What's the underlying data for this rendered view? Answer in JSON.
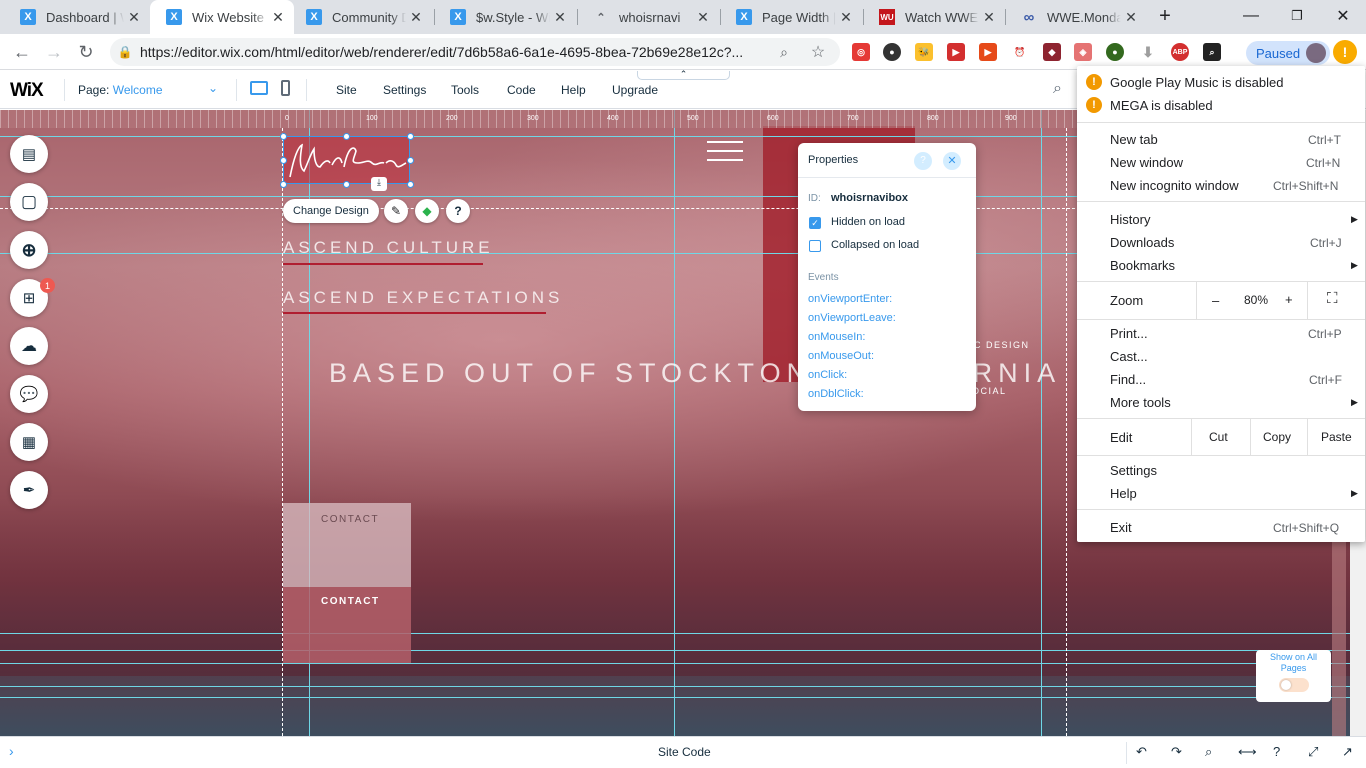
{
  "browser": {
    "tabs": [
      {
        "title": "Dashboard | Wix",
        "icon": "wix-icon"
      },
      {
        "title": "Wix Website Editor",
        "icon": "wix-icon"
      },
      {
        "title": "Community Discussion",
        "icon": "wix-icon"
      },
      {
        "title": "$w.Style - Wix Code",
        "icon": "wix-icon"
      },
      {
        "title": "whoisrnavi",
        "icon": "site-icon"
      },
      {
        "title": "Page Width | Help",
        "icon": "wix-icon"
      },
      {
        "title": "Watch WWE Raw",
        "icon": "wwe-icon"
      },
      {
        "title": "WWE.Monday Night",
        "icon": "infinity-icon"
      }
    ],
    "url": "https://editor.wix.com/html/editor/web/renderer/edit/7d6b58a6-6a1e-4695-8bea-72b69e28e12c?...",
    "paused_label": "Paused"
  },
  "wix_bar": {
    "logo": "WiX",
    "page_label": "Page:",
    "page_value": "Welcome",
    "menu": [
      "Site",
      "Settings",
      "Tools",
      "Code",
      "Help",
      "Upgrade"
    ]
  },
  "ruler": {
    "ticks": [
      "0",
      "100",
      "200",
      "300",
      "400",
      "500",
      "600",
      "700",
      "800",
      "900"
    ]
  },
  "stage": {
    "change_design": "Change Design",
    "heading1": "ASCEND CULTURE",
    "heading2": "ASCEND EXPECTATIONS",
    "heading3": "BASED OUT OF STOCKTON, CALIFORNIA",
    "partial1": "IC DESIGN",
    "partial2": "OCIAL",
    "contact1": "CONTACT",
    "contact2": "CONTACT",
    "show_on_all": "Show on All Pages",
    "add_badge": "1"
  },
  "properties": {
    "title": "Properties",
    "id_label": "ID:",
    "id_value": "whoisrnavibox",
    "hidden": {
      "label": "Hidden on load",
      "checked": true
    },
    "collapsed": {
      "label": "Collapsed on load",
      "checked": false
    },
    "events_title": "Events",
    "events": [
      "onViewportEnter:",
      "onViewportLeave:",
      "onMouseIn:",
      "onMouseOut:",
      "onClick:",
      "onDblClick:"
    ]
  },
  "bottom": {
    "site_code": "Site Code"
  },
  "chrome_menu": {
    "warnings": [
      "Google Play Music is disabled",
      "MEGA is disabled"
    ],
    "new_tab": {
      "label": "New tab",
      "shortcut": "Ctrl+T"
    },
    "new_window": {
      "label": "New window",
      "shortcut": "Ctrl+N"
    },
    "incognito": {
      "label": "New incognito window",
      "shortcut": "Ctrl+Shift+N"
    },
    "history": "History",
    "downloads": {
      "label": "Downloads",
      "shortcut": "Ctrl+J"
    },
    "bookmarks": "Bookmarks",
    "zoom": {
      "label": "Zoom",
      "minus": "–",
      "value": "80%",
      "plus": "+"
    },
    "print": {
      "label": "Print...",
      "shortcut": "Ctrl+P"
    },
    "cast": "Cast...",
    "find": {
      "label": "Find...",
      "shortcut": "Ctrl+F"
    },
    "more_tools": "More tools",
    "edit": {
      "label": "Edit",
      "cut": "Cut",
      "copy": "Copy",
      "paste": "Paste"
    },
    "settings": "Settings",
    "help": "Help",
    "exit": {
      "label": "Exit",
      "shortcut": "Ctrl+Shift+Q"
    }
  },
  "colors": {
    "wix_blue": "#3899ec",
    "accent_red": "#b01e30",
    "warning": "#f29900"
  }
}
